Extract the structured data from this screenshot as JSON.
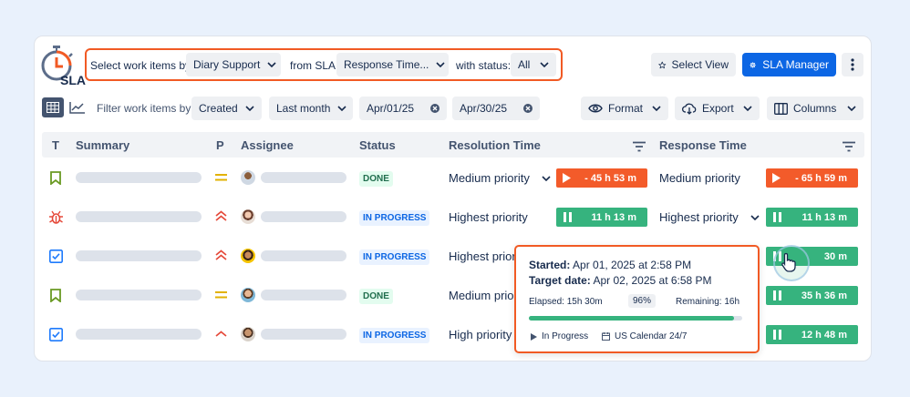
{
  "logo": {
    "text": "SLA"
  },
  "filter": {
    "select_label": "Select work items by:",
    "select_value": "Diary Support",
    "sla_label": "from SLA:",
    "sla_value": "Response Time...",
    "status_label": "with status:",
    "status_value": "All"
  },
  "toolbar": {
    "select_view": "Select View",
    "sla_manager": "SLA Manager",
    "filter_by_label": "Filter work items by:",
    "created": "Created",
    "last_month": "Last month",
    "date_from": "Apr/01/25",
    "date_to": "Apr/30/25",
    "format": "Format",
    "export": "Export",
    "columns": "Columns"
  },
  "table": {
    "headers": {
      "type": "T",
      "summary": "Summary",
      "priority": "P",
      "assignee": "Assignee",
      "status": "Status",
      "resolution": "Resolution Time",
      "response": "Response Time"
    },
    "rows": [
      {
        "type_icon": "bookmark-icon",
        "priority_icon": "medium-priority-icon",
        "status": "DONE",
        "resolution_text": "Medium priority",
        "resolution_timer": "- 45 h 53 m",
        "response_text": "Medium priority",
        "response_timer": "- 65 h 59 m"
      },
      {
        "type_icon": "bug-icon",
        "priority_icon": "highest-priority-icon",
        "status": "IN PROGRESS",
        "resolution_text": "Highest priority",
        "resolution_timer": "11 h 13 m",
        "response_text": "Highest priority",
        "response_timer": "11 h 13 m"
      },
      {
        "type_icon": "checkbox-icon",
        "priority_icon": "highest-priority-icon",
        "status": "IN PROGRESS",
        "resolution_text": "Highest priori",
        "resolution_timer": "",
        "response_text": "",
        "response_timer": "30 m"
      },
      {
        "type_icon": "bookmark-icon",
        "priority_icon": "medium-priority-icon",
        "status": "DONE",
        "resolution_text": "Medium prio",
        "resolution_timer": "",
        "response_text": "",
        "response_timer": "35 h 36 m"
      },
      {
        "type_icon": "checkbox-icon",
        "priority_icon": "high-priority-icon",
        "status": "IN PROGRESS",
        "resolution_text": "High priority",
        "resolution_timer": "",
        "response_text": "",
        "response_timer": "12 h 48 m"
      }
    ]
  },
  "tooltip": {
    "started_label": "Started:",
    "started_value": "Apr 01, 2025 at 2:58 PM",
    "target_label": "Target date:",
    "target_value": "Apr 02, 2025 at 6:58 PM",
    "elapsed": "Elapsed: 15h 30m",
    "percent": "96%",
    "remaining": "Remaining: 16h",
    "progress_fraction": 0.96,
    "state": "In Progress",
    "calendar": "US Calendar 24/7"
  },
  "colors": {
    "accent": "#0c66e4",
    "highlight": "#f15a24",
    "timer_green": "#36b37e",
    "timer_red": "#f35b2a"
  }
}
